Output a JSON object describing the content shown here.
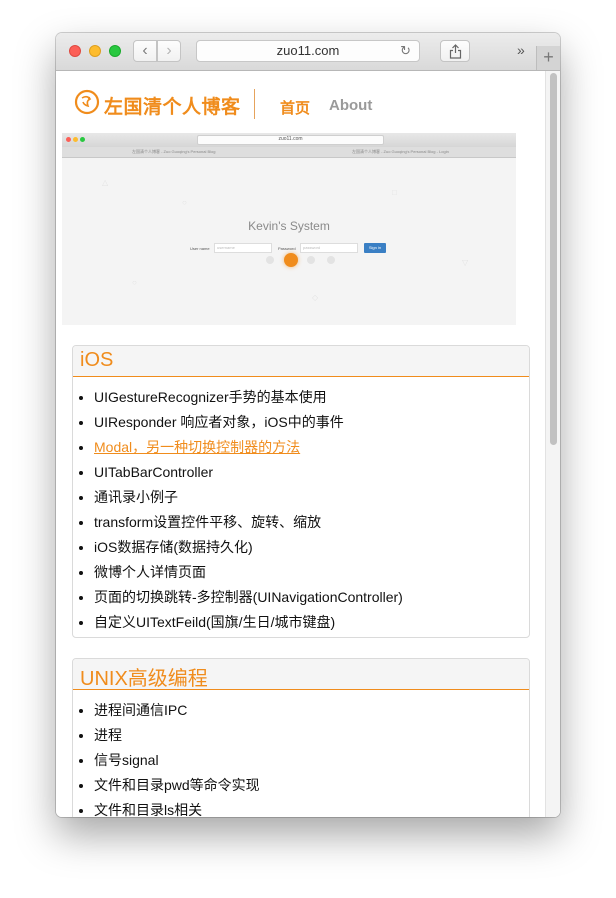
{
  "browser": {
    "url": "zuo11.com"
  },
  "header": {
    "logo_text": "左国清个人博客",
    "nav": {
      "home": "首页",
      "about": "About"
    }
  },
  "carousel": {
    "screenshot_url": "zuo11.com",
    "screenshot_tab_left": "左国清个人博客 - Zuo Guoqing's Personal Blog",
    "screenshot_tab_right": "左国清个人博客 - Zuo Guoqing's Personal Blog - Login",
    "screenshot_title": "Kevin's System",
    "username_label": "User name",
    "username_placeholder": "username",
    "password_label": "Password",
    "password_placeholder": "password",
    "signin_label": "Sign in",
    "slide_count": 4,
    "active_slide": 2,
    "accent": "#f08c1c"
  },
  "sections": [
    {
      "title": "iOS",
      "items": [
        "UIGestureRecognizer手势的基本使用",
        "UIResponder 响应者对象，iOS中的事件",
        "Modal，另一种切换控制器的方法",
        "UITabBarController",
        "通讯录小例子",
        "transform设置控件平移、旋转、缩放",
        "iOS数据存储(数据持久化)",
        "微博个人详情页面",
        "页面的切换跳转-多控制器(UINavigationController)",
        "自定义UITextFeild(国旗/生日/城市键盘)"
      ],
      "active_index": 2
    },
    {
      "title": "UNIX高级编程",
      "items": [
        "进程间通信IPC",
        "进程",
        "信号signal",
        "文件和目录pwd等命令实现",
        "文件和目录ls相关"
      ]
    }
  ]
}
